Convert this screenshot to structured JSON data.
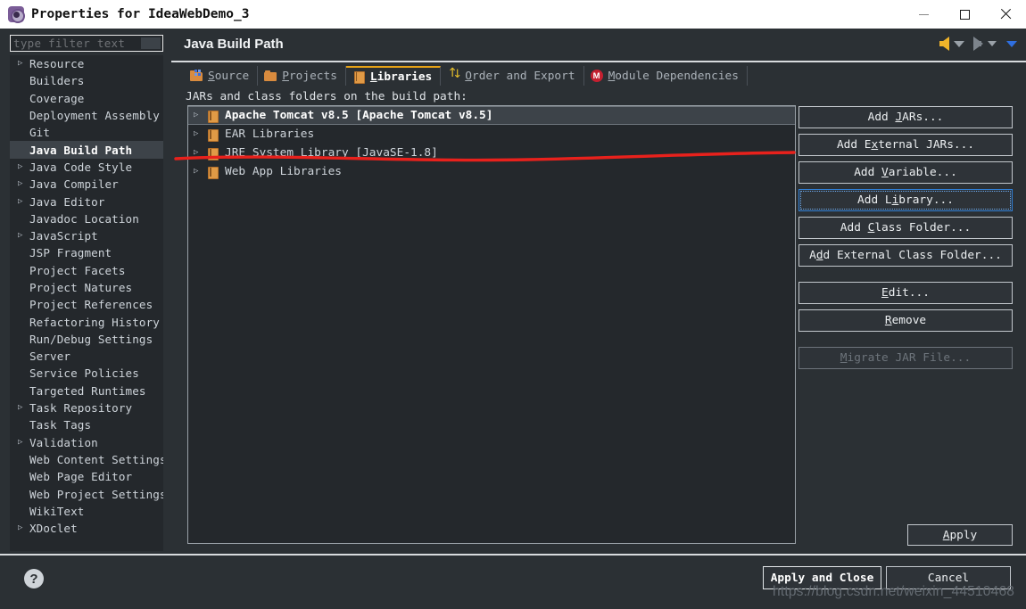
{
  "window": {
    "title": "Properties for IdeaWebDemo_3",
    "icon": "gear-icon",
    "controls": {
      "minimize": "minimize-icon",
      "maximize": "maximize-icon",
      "close": "close-icon"
    }
  },
  "sidebar": {
    "filter_placeholder": "type filter text",
    "items": [
      {
        "label": "Resource",
        "expandable": true,
        "selected": false
      },
      {
        "label": "Builders",
        "expandable": false,
        "selected": false
      },
      {
        "label": "Coverage",
        "expandable": false,
        "selected": false
      },
      {
        "label": "Deployment Assembly",
        "expandable": false,
        "selected": false
      },
      {
        "label": "Git",
        "expandable": false,
        "selected": false
      },
      {
        "label": "Java Build Path",
        "expandable": false,
        "selected": true
      },
      {
        "label": "Java Code Style",
        "expandable": true,
        "selected": false
      },
      {
        "label": "Java Compiler",
        "expandable": true,
        "selected": false
      },
      {
        "label": "Java Editor",
        "expandable": true,
        "selected": false
      },
      {
        "label": "Javadoc Location",
        "expandable": false,
        "selected": false
      },
      {
        "label": "JavaScript",
        "expandable": true,
        "selected": false
      },
      {
        "label": "JSP Fragment",
        "expandable": false,
        "selected": false
      },
      {
        "label": "Project Facets",
        "expandable": false,
        "selected": false
      },
      {
        "label": "Project Natures",
        "expandable": false,
        "selected": false
      },
      {
        "label": "Project References",
        "expandable": false,
        "selected": false
      },
      {
        "label": "Refactoring History",
        "expandable": false,
        "selected": false
      },
      {
        "label": "Run/Debug Settings",
        "expandable": false,
        "selected": false
      },
      {
        "label": "Server",
        "expandable": false,
        "selected": false
      },
      {
        "label": "Service Policies",
        "expandable": false,
        "selected": false
      },
      {
        "label": "Targeted Runtimes",
        "expandable": false,
        "selected": false
      },
      {
        "label": "Task Repository",
        "expandable": true,
        "selected": false
      },
      {
        "label": "Task Tags",
        "expandable": false,
        "selected": false
      },
      {
        "label": "Validation",
        "expandable": true,
        "selected": false
      },
      {
        "label": "Web Content Settings",
        "expandable": false,
        "selected": false
      },
      {
        "label": "Web Page Editor",
        "expandable": false,
        "selected": false
      },
      {
        "label": "Web Project Settings",
        "expandable": false,
        "selected": false
      },
      {
        "label": "WikiText",
        "expandable": false,
        "selected": false
      },
      {
        "label": "XDoclet",
        "expandable": true,
        "selected": false
      }
    ]
  },
  "main": {
    "title": "Java Build Path",
    "nav": {
      "back": "back-arrow-icon",
      "forward": "forward-arrow-icon",
      "menu": "dropdown-arrow-icon"
    },
    "tabs": [
      {
        "label": "Source",
        "mnemonic": "S",
        "icon": "source-folder-icon",
        "active": false
      },
      {
        "label": "Projects",
        "mnemonic": "P",
        "icon": "projects-folder-icon",
        "active": false
      },
      {
        "label": "Libraries",
        "mnemonic": "L",
        "icon": "library-book-icon",
        "active": true
      },
      {
        "label": "Order and Export",
        "mnemonic": "O",
        "icon": "order-arrows-icon",
        "active": false
      },
      {
        "label": "Module Dependencies",
        "mnemonic": "M",
        "icon": "module-badge-icon",
        "active": false
      }
    ],
    "content_label": "JARs and class folders on the build path:",
    "libraries": [
      {
        "label": "Apache Tomcat v8.5 [Apache Tomcat v8.5]",
        "selected": true
      },
      {
        "label": "EAR Libraries",
        "selected": false
      },
      {
        "label": "JRE System Library [JavaSE-1.8]",
        "selected": false
      },
      {
        "label": "Web App Libraries",
        "selected": false
      }
    ],
    "buttons": [
      {
        "label": "Add JARs...",
        "state": "normal"
      },
      {
        "label": "Add External JARs...",
        "state": "normal"
      },
      {
        "label": "Add Variable...",
        "state": "normal"
      },
      {
        "label": "Add Library...",
        "state": "focused"
      },
      {
        "label": "Add Class Folder...",
        "state": "normal"
      },
      {
        "label": "Add External Class Folder...",
        "state": "normal"
      },
      {
        "label": "Edit...",
        "state": "normal"
      },
      {
        "label": "Remove",
        "state": "normal"
      },
      {
        "label": "Migrate JAR File...",
        "state": "disabled"
      }
    ],
    "apply_label": "Apply"
  },
  "footer": {
    "help": "?",
    "apply_and_close": "Apply and Close",
    "cancel": "Cancel"
  },
  "watermark": "https://blog.csdn.net/weixin_44510468",
  "colors": {
    "background": "#2b3034",
    "panel": "#24282c",
    "selection": "#3d4349",
    "active_tab_accent": "#e8a317",
    "focus_ring": "#2f7fd6",
    "annotation_red": "#e8211c",
    "titlebar": "#ffffff"
  }
}
